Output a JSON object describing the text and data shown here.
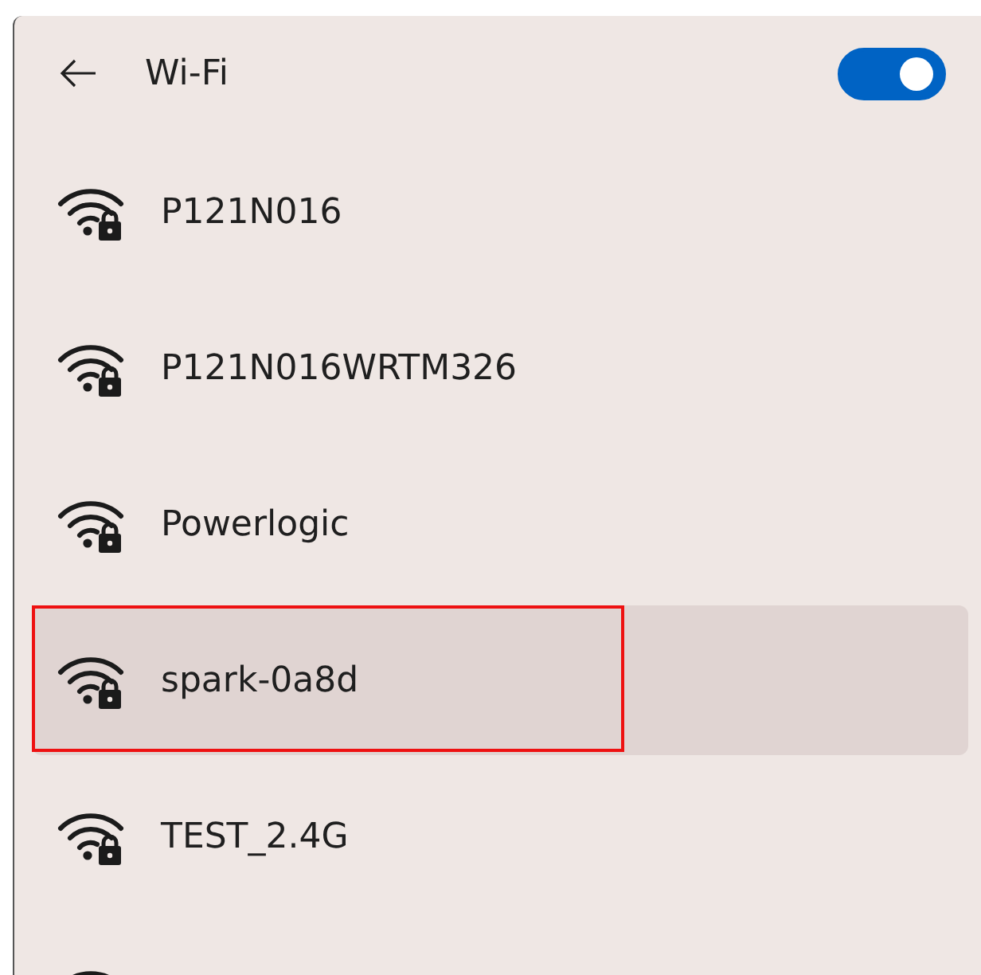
{
  "header": {
    "title": "Wi-Fi",
    "on": true
  },
  "networks": [
    {
      "name": "P121N016",
      "selected": false,
      "marked": false
    },
    {
      "name": "P121N016WRTM326",
      "selected": false,
      "marked": false
    },
    {
      "name": "Powerlogic",
      "selected": false,
      "marked": false
    },
    {
      "name": "spark-0a8d",
      "selected": true,
      "marked": true
    },
    {
      "name": "TEST_2.4G",
      "selected": false,
      "marked": false
    }
  ]
}
